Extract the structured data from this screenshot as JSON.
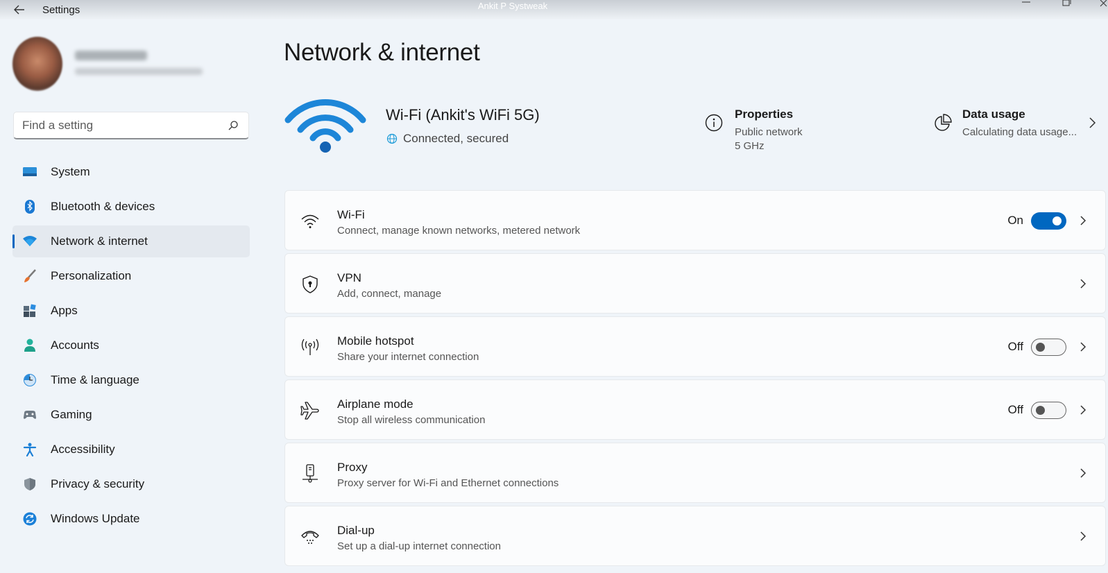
{
  "titlebar": {
    "app_name": "Settings",
    "window_title": "Ankit P Systweak"
  },
  "search": {
    "placeholder": "Find a setting"
  },
  "sidebar": {
    "items": [
      {
        "label": "System"
      },
      {
        "label": "Bluetooth & devices"
      },
      {
        "label": "Network & internet",
        "selected": true
      },
      {
        "label": "Personalization"
      },
      {
        "label": "Apps"
      },
      {
        "label": "Accounts"
      },
      {
        "label": "Time & language"
      },
      {
        "label": "Gaming"
      },
      {
        "label": "Accessibility"
      },
      {
        "label": "Privacy & security"
      },
      {
        "label": "Windows Update"
      }
    ]
  },
  "main": {
    "title": "Network & internet",
    "hero": {
      "network_name": "Wi-Fi (Ankit's WiFi 5G)",
      "status": "Connected, secured"
    },
    "properties": {
      "title": "Properties",
      "line1": "Public network",
      "line2": "5 GHz"
    },
    "data_usage": {
      "title": "Data usage",
      "subtitle": "Calculating data usage..."
    },
    "cards": [
      {
        "title": "Wi-Fi",
        "subtitle": "Connect, manage known networks, metered network",
        "state": "On"
      },
      {
        "title": "VPN",
        "subtitle": "Add, connect, manage"
      },
      {
        "title": "Mobile hotspot",
        "subtitle": "Share your internet connection",
        "state": "Off"
      },
      {
        "title": "Airplane mode",
        "subtitle": "Stop all wireless communication",
        "state": "Off"
      },
      {
        "title": "Proxy",
        "subtitle": "Proxy server for Wi-Fi and Ethernet connections"
      },
      {
        "title": "Dial-up",
        "subtitle": "Set up a dial-up internet connection"
      }
    ]
  },
  "colors": {
    "accent": "#0067c0",
    "background": "#eff4f9",
    "card": "#fbfcfd"
  },
  "icons": {
    "titlebar": [
      "back-arrow-icon",
      "minimize-icon",
      "maximize-icon",
      "close-icon"
    ],
    "sidebar": [
      "system-icon",
      "bluetooth-icon",
      "network-icon",
      "personalization-icon",
      "apps-icon",
      "accounts-icon",
      "time-language-icon",
      "gaming-icon",
      "accessibility-icon",
      "privacy-icon",
      "windows-update-icon"
    ],
    "cards": [
      "wifi-icon",
      "vpn-shield-icon",
      "hotspot-icon",
      "airplane-icon",
      "proxy-icon",
      "dialup-icon"
    ]
  }
}
